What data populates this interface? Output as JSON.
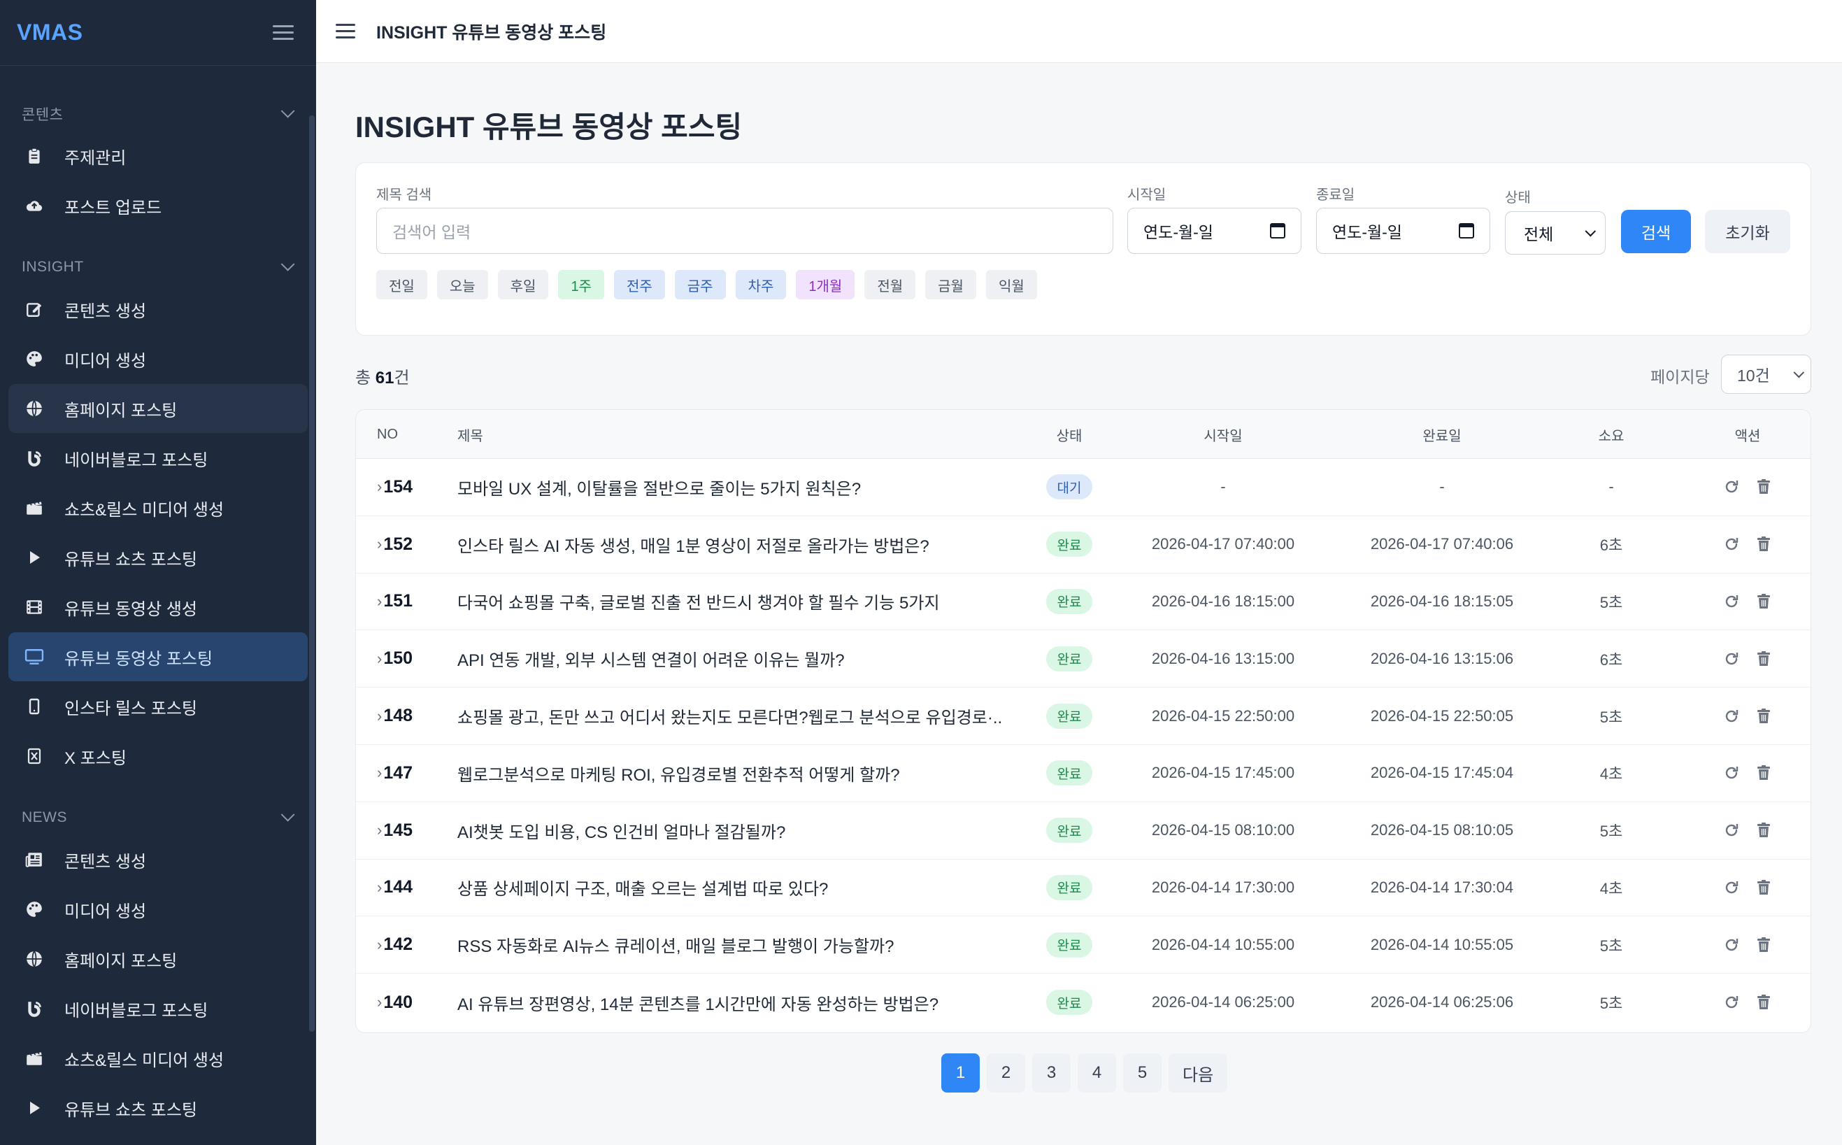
{
  "app": {
    "logo": "VMAS"
  },
  "topbar": {
    "title": "INSIGHT 유튜브 동영상 포스팅"
  },
  "sidebar": {
    "groups": [
      {
        "title": "콘텐츠",
        "items": [
          {
            "label": "주제관리",
            "icon": "clipboard-icon"
          },
          {
            "label": "포스트 업로드",
            "icon": "cloud-upload-icon"
          }
        ]
      },
      {
        "title": "INSIGHT",
        "items": [
          {
            "label": "콘텐츠 생성",
            "icon": "edit-icon"
          },
          {
            "label": "미디어 생성",
            "icon": "palette-icon"
          },
          {
            "label": "홈페이지 포스팅",
            "icon": "globe-icon"
          },
          {
            "label": "네이버블로그 포스팅",
            "icon": "blog-icon"
          },
          {
            "label": "쇼츠&릴스 미디어 생성",
            "icon": "clapperboard-icon"
          },
          {
            "label": "유튜브 쇼츠 포스팅",
            "icon": "play-icon"
          },
          {
            "label": "유튜브 동영상 생성",
            "icon": "film-icon"
          },
          {
            "label": "유튜브 동영상 포스팅",
            "icon": "monitor-icon"
          },
          {
            "label": "인스타 릴스 포스팅",
            "icon": "mobile-icon"
          },
          {
            "label": "X 포스팅",
            "icon": "x-icon"
          }
        ]
      },
      {
        "title": "NEWS",
        "items": [
          {
            "label": "콘텐츠 생성",
            "icon": "newspaper-icon"
          },
          {
            "label": "미디어 생성",
            "icon": "palette-icon"
          },
          {
            "label": "홈페이지 포스팅",
            "icon": "globe-icon"
          },
          {
            "label": "네이버블로그 포스팅",
            "icon": "blog-icon"
          },
          {
            "label": "쇼츠&릴스 미디어 생성",
            "icon": "clapperboard-icon"
          },
          {
            "label": "유튜브 쇼츠 포스팅",
            "icon": "play-icon"
          }
        ]
      }
    ]
  },
  "page": {
    "title": "INSIGHT 유튜브 동영상 포스팅"
  },
  "filter": {
    "title_label": "제목 검색",
    "title_placeholder": "검색어 입력",
    "start_label": "시작일",
    "start_value": "연도-월-일",
    "end_label": "종료일",
    "end_value": "연도-월-일",
    "status_label": "상태",
    "status_value": "전체",
    "search_button": "검색",
    "reset_button": "초기화",
    "chips": [
      {
        "label": "전일",
        "tone": "gray"
      },
      {
        "label": "오늘",
        "tone": "gray"
      },
      {
        "label": "후일",
        "tone": "gray"
      },
      {
        "label": "1주",
        "tone": "green"
      },
      {
        "label": "전주",
        "tone": "blue"
      },
      {
        "label": "금주",
        "tone": "blue"
      },
      {
        "label": "차주",
        "tone": "blue"
      },
      {
        "label": "1개월",
        "tone": "purple"
      },
      {
        "label": "전월",
        "tone": "gray"
      },
      {
        "label": "금월",
        "tone": "gray"
      },
      {
        "label": "익월",
        "tone": "gray"
      }
    ]
  },
  "summary": {
    "prefix": "총",
    "count": "61",
    "suffix": "건",
    "per_page_label": "페이지당",
    "per_page_value": "10건"
  },
  "table": {
    "headers": {
      "no": "NO",
      "title": "제목",
      "status": "상태",
      "start": "시작일",
      "end": "완료일",
      "duration": "소요",
      "action": "액션"
    },
    "rows": [
      {
        "no": "154",
        "title": "모바일 UX 설계, 이탈률을 절반으로 줄이는 5가지 원칙은?",
        "status": "대기",
        "status_type": "wait",
        "start": "-",
        "end": "-",
        "duration": "-"
      },
      {
        "no": "152",
        "title": "인스타 릴스 AI 자동 생성, 매일 1분 영상이 저절로 올라가는 방법은?",
        "status": "완료",
        "status_type": "done",
        "start": "2026-04-17 07:40:00",
        "end": "2026-04-17 07:40:06",
        "duration": "6초"
      },
      {
        "no": "151",
        "title": "다국어 쇼핑몰 구축, 글로벌 진출 전 반드시 챙겨야 할 필수 기능 5가지",
        "status": "완료",
        "status_type": "done",
        "start": "2026-04-16 18:15:00",
        "end": "2026-04-16 18:15:05",
        "duration": "5초"
      },
      {
        "no": "150",
        "title": "API 연동 개발, 외부 시스템 연결이 어려운 이유는 뭘까?",
        "status": "완료",
        "status_type": "done",
        "start": "2026-04-16 13:15:00",
        "end": "2026-04-16 13:15:06",
        "duration": "6초"
      },
      {
        "no": "148",
        "title": "쇼핑몰 광고, 돈만 쓰고 어디서 왔는지도 모른다면?웹로그 분석으로 유입경로·...",
        "status": "완료",
        "status_type": "done",
        "start": "2026-04-15 22:50:00",
        "end": "2026-04-15 22:50:05",
        "duration": "5초"
      },
      {
        "no": "147",
        "title": "웹로그분석으로 마케팅 ROI, 유입경로별 전환추적 어떻게 할까?",
        "status": "완료",
        "status_type": "done",
        "start": "2026-04-15 17:45:00",
        "end": "2026-04-15 17:45:04",
        "duration": "4초"
      },
      {
        "no": "145",
        "title": "AI챗봇 도입 비용, CS 인건비 얼마나 절감될까?",
        "status": "완료",
        "status_type": "done",
        "start": "2026-04-15 08:10:00",
        "end": "2026-04-15 08:10:05",
        "duration": "5초"
      },
      {
        "no": "144",
        "title": "상품 상세페이지 구조, 매출 오르는 설계법 따로 있다?",
        "status": "완료",
        "status_type": "done",
        "start": "2026-04-14 17:30:00",
        "end": "2026-04-14 17:30:04",
        "duration": "4초"
      },
      {
        "no": "142",
        "title": "RSS 자동화로 AI뉴스 큐레이션, 매일 블로그 발행이 가능할까?",
        "status": "완료",
        "status_type": "done",
        "start": "2026-04-14 10:55:00",
        "end": "2026-04-14 10:55:05",
        "duration": "5초"
      },
      {
        "no": "140",
        "title": "AI 유튜브 장편영상, 14분 콘텐츠를 1시간만에 자동 완성하는 방법은?",
        "status": "완료",
        "status_type": "done",
        "start": "2026-04-14 06:25:00",
        "end": "2026-04-14 06:25:06",
        "duration": "5초"
      }
    ]
  },
  "pagination": {
    "pages": [
      "1",
      "2",
      "3",
      "4",
      "5"
    ],
    "active": "1",
    "next": "다음"
  },
  "colors": {
    "primary": "#2f86f6",
    "sidebar_bg": "#1e2a3b",
    "active_item_bg": "#27456f",
    "done_badge": "#d9f7e4",
    "wait_badge": "#dde9fb"
  }
}
